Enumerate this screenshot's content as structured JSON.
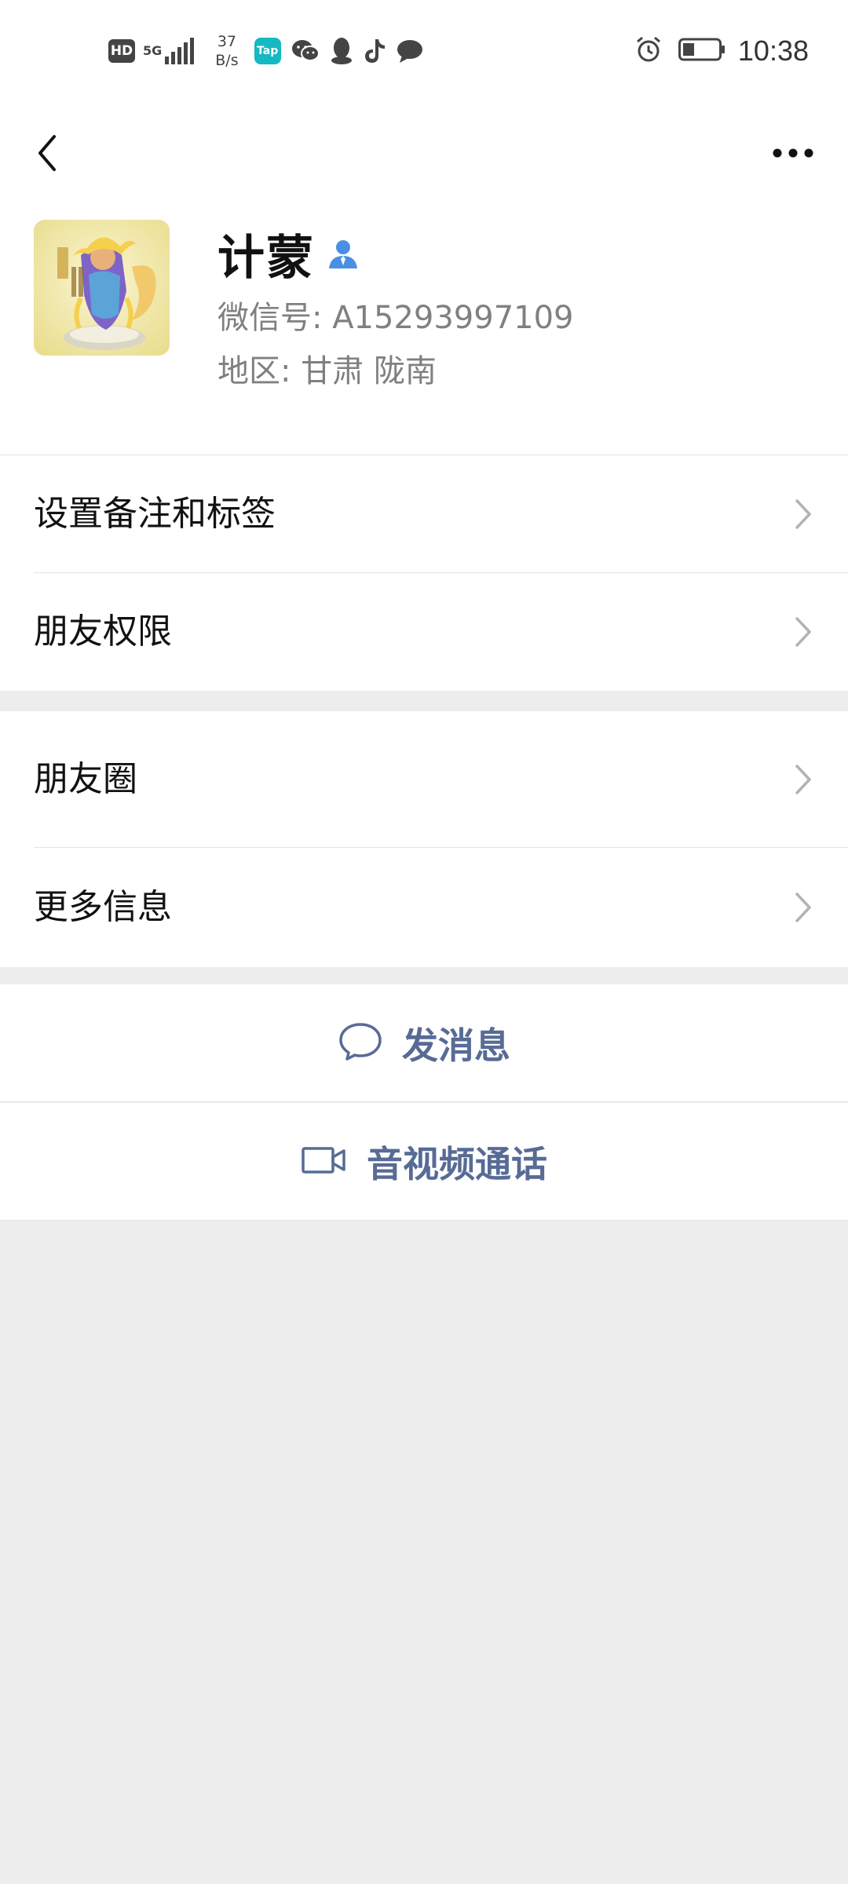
{
  "status_bar": {
    "hd": "HD",
    "network": "5G",
    "speed_value": "37",
    "speed_unit": "B/s",
    "tap_app": "Tap",
    "time": "10:38"
  },
  "profile": {
    "name": "计蒙",
    "wechat_id": "微信号:  A15293997109",
    "region": "地区:  甘肃  陇南"
  },
  "group1": {
    "items": [
      {
        "label": "设置备注和标签"
      },
      {
        "label": "朋友权限"
      }
    ]
  },
  "group2": {
    "items": [
      {
        "label": "朋友圈"
      },
      {
        "label": "更多信息"
      }
    ]
  },
  "actions": {
    "message": "发消息",
    "call": "音视频通话"
  },
  "colors": {
    "link": "#576b95",
    "background": "#ededed",
    "verified_icon": "#4a90e2"
  }
}
